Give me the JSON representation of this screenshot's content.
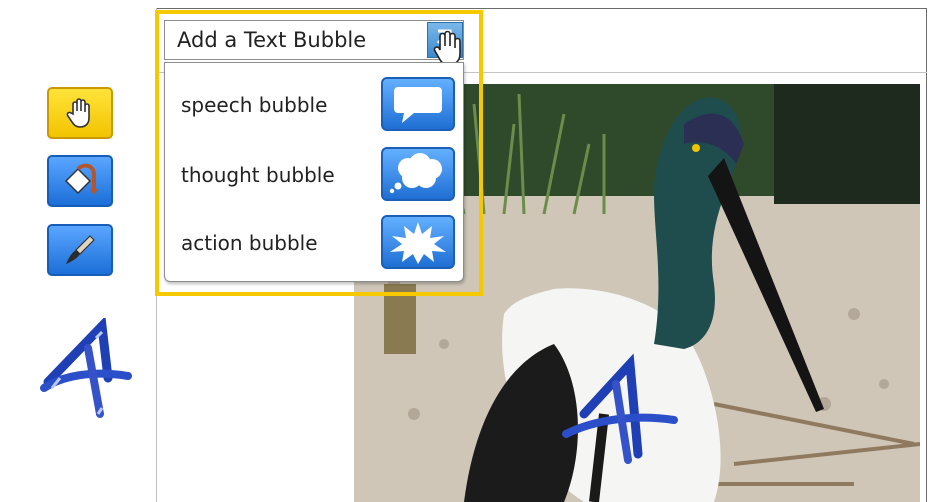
{
  "dropdown": {
    "title": "Add a Text Bubble",
    "items": [
      {
        "label": "speech bubble",
        "icon": "speech-bubble-icon"
      },
      {
        "label": "thought bubble",
        "icon": "thought-bubble-icon"
      },
      {
        "label": "action bubble",
        "icon": "action-bubble-icon"
      }
    ]
  },
  "toolbar": {
    "tools": [
      {
        "name": "hand",
        "icon": "hand-icon",
        "selected": true
      },
      {
        "name": "fill",
        "icon": "paint-bucket-icon",
        "selected": false
      },
      {
        "name": "brush",
        "icon": "paintbrush-icon",
        "selected": false
      }
    ]
  },
  "colors": {
    "highlight": "#f5c800",
    "tool_blue": "#1c6fd8",
    "tool_yellow": "#f2c400"
  }
}
